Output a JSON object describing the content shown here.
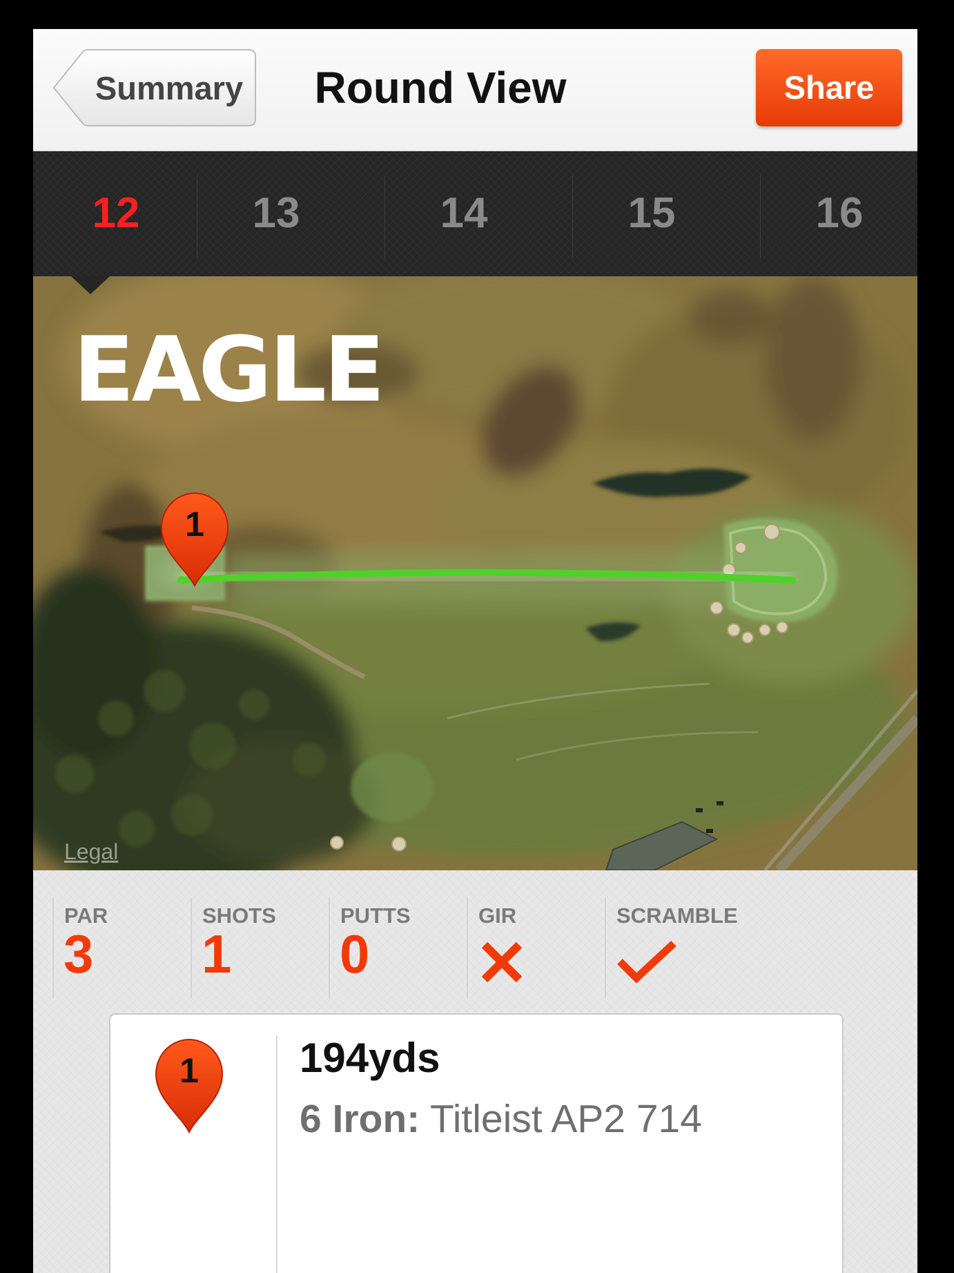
{
  "nav": {
    "back_label": "Summary",
    "title": "Round View",
    "share_label": "Share"
  },
  "holes": {
    "selected": "12",
    "tabs": [
      "12",
      "13",
      "14",
      "15",
      "16"
    ]
  },
  "map": {
    "result": "EAGLE",
    "legal": "Legal",
    "shot_marker": "1",
    "shot_line_color": "#4fd12a"
  },
  "stats": {
    "par": {
      "label": "PAR",
      "value": "3"
    },
    "shots": {
      "label": "SHOTS",
      "value": "1"
    },
    "putts": {
      "label": "PUTTS",
      "value": "0"
    },
    "gir": {
      "label": "GIR",
      "icon": "cross-icon"
    },
    "scramble": {
      "label": "SCRAMBLE",
      "icon": "check-icon"
    }
  },
  "shot": {
    "number": "1",
    "distance": "194yds",
    "club": "6 Iron:",
    "ball": "Titleist AP2 714"
  },
  "colors": {
    "accent": "#f23a08",
    "selected_hole": "#ff1f1f"
  }
}
